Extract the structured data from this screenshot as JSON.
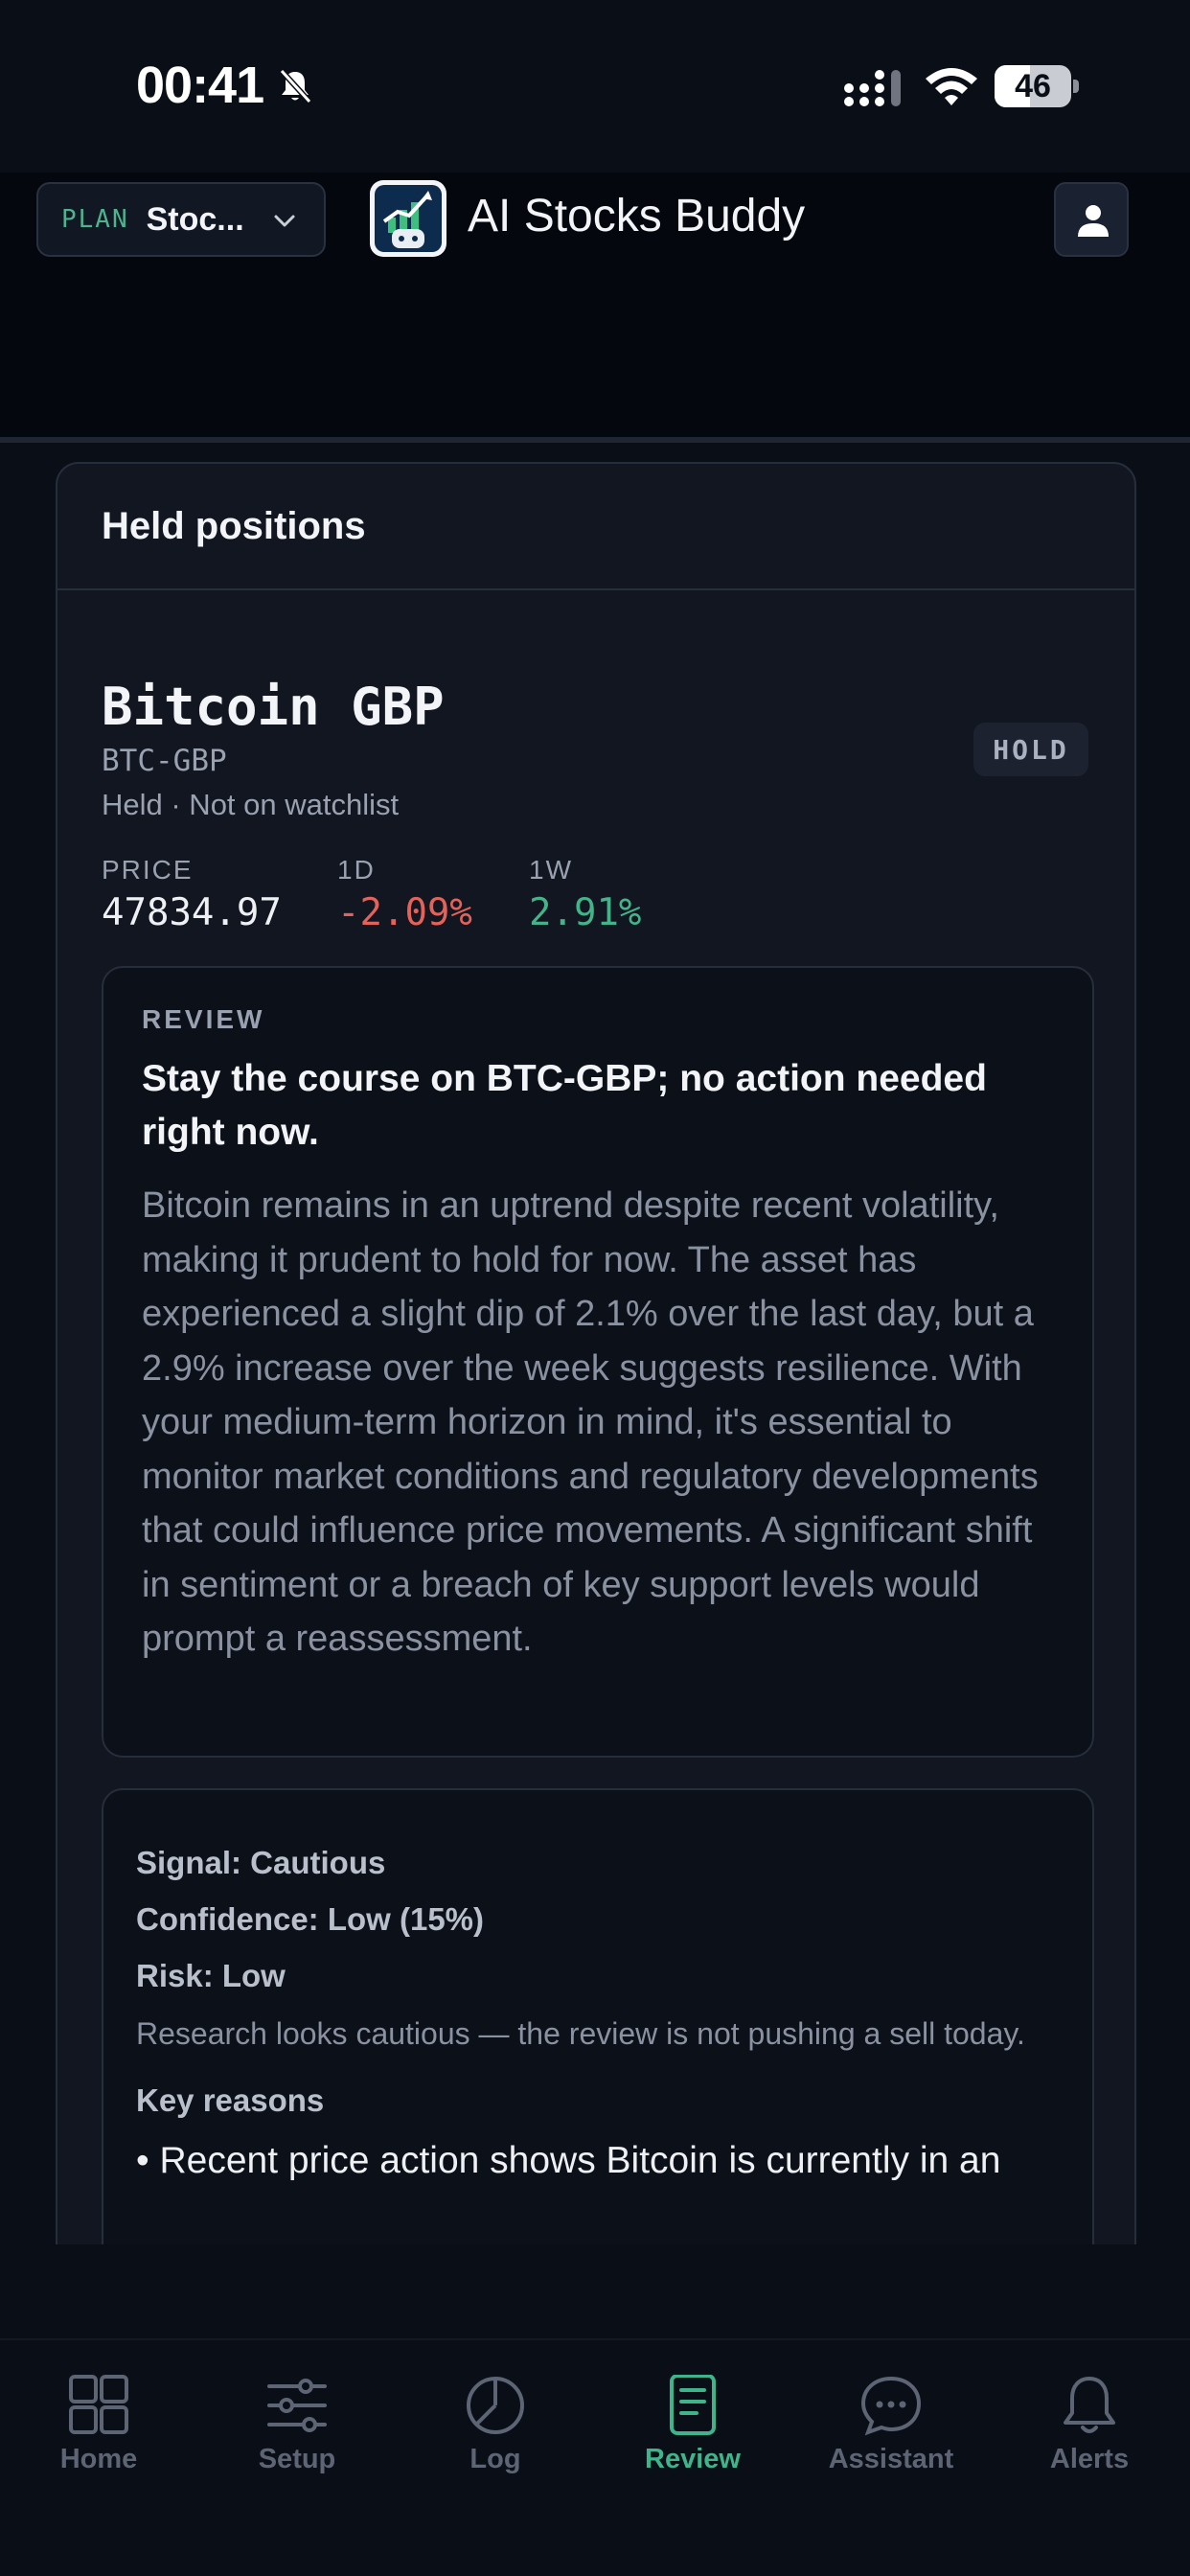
{
  "status_bar": {
    "time": "00:41",
    "battery": "46",
    "battery_level": 0.46
  },
  "header": {
    "plan_label": "PLAN",
    "plan_value": "Stoc...",
    "app_title": "AI Stocks Buddy"
  },
  "card": {
    "title": "Held positions",
    "asset": {
      "name": "Bitcoin GBP",
      "ticker": "BTC-GBP",
      "meta": "Held · Not on watchlist",
      "badge": "HOLD"
    },
    "metrics": [
      {
        "label": "PRICE",
        "value": "47834.97"
      },
      {
        "label": "1D",
        "value": "-2.09%"
      },
      {
        "label": "1W",
        "value": "2.91%"
      }
    ],
    "review": {
      "label": "REVIEW",
      "headline": "Stay the course on BTC-GBP; no action needed right now.",
      "body": "Bitcoin remains in an uptrend despite recent volatility, making it prudent to hold for now. The asset has experienced a slight dip of 2.1% over the last day, but a 2.9% increase over the week suggests resilience. With your medium-term horizon in mind, it's essential to monitor market conditions and regulatory developments that could influence price movements. A significant shift in sentiment or a breach of key support levels would prompt a reassessment."
    },
    "signals": {
      "signal": "Signal: Cautious",
      "confidence": "Confidence: Low (15%)",
      "risk": "Risk: Low",
      "note": "Research looks cautious — the review is not pushing a sell today.",
      "key_reasons_label": "Key reasons",
      "reasons": [
        "• Recent price action shows Bitcoin is currently in an"
      ]
    }
  },
  "tabs": [
    {
      "label": "Home",
      "icon": "grid-icon"
    },
    {
      "label": "Setup",
      "icon": "sliders-icon"
    },
    {
      "label": "Log",
      "icon": "pie-chart-icon"
    },
    {
      "label": "Review",
      "icon": "document-icon"
    },
    {
      "label": "Assistant",
      "icon": "chat-bubble-icon"
    },
    {
      "label": "Alerts",
      "icon": "bell-icon"
    }
  ],
  "colors": {
    "accent": "#3fb389",
    "negative": "#e3625a",
    "positive": "#44b38a",
    "background": "#0a0e17",
    "card": "#111621"
  }
}
